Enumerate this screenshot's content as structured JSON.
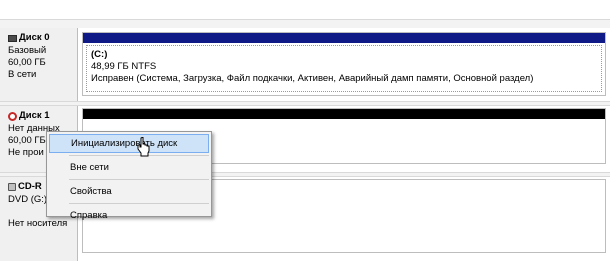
{
  "disks": [
    {
      "title": "Диск 0",
      "lines": [
        "Базовый",
        "60,00 ГБ",
        "В сети"
      ],
      "volume": {
        "letter": "(C:)",
        "size_fs": "48,99 ГБ NTFS",
        "status": "Исправен (Система, Загрузка, Файл подкачки, Активен, Аварийный дамп памяти, Основной раздел)"
      }
    },
    {
      "title": "Диск 1",
      "lines": [
        "Нет данных",
        "60,00 ГБ",
        "Не прои"
      ]
    },
    {
      "title": "CD-R",
      "lines": [
        "DVD (G:)",
        "",
        "Нет носителя"
      ]
    }
  ],
  "context_menu": {
    "items": [
      "Инициализировать диск",
      "Вне сети",
      "Свойства",
      "Справка"
    ]
  },
  "colors": {
    "primary_partition_bar": "#0f1a86",
    "unallocated_bar": "#000000",
    "menu_hover": "#cfe3f8"
  }
}
